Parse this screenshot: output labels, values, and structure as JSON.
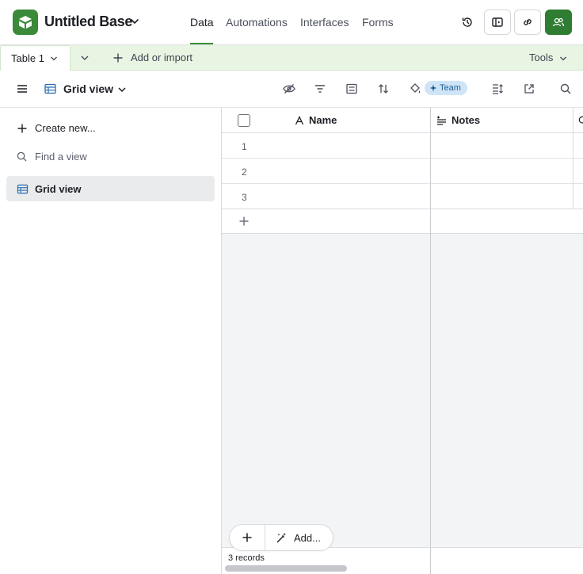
{
  "header": {
    "base_title": "Untitled Base",
    "nav": {
      "data": "Data",
      "automations": "Automations",
      "interfaces": "Interfaces",
      "forms": "Forms"
    },
    "icons": [
      "history-icon",
      "launch-interface-icon",
      "share-link-icon",
      "collaborators-icon"
    ]
  },
  "tablebar": {
    "table_tab": "Table 1",
    "add_import": "Add or import",
    "tools": "Tools"
  },
  "viewbar": {
    "view_name": "Grid view",
    "team_badge": "Team"
  },
  "sidebar": {
    "create_new": "Create new...",
    "find_view_placeholder": "Find a view",
    "views": [
      {
        "label": "Grid view",
        "selected": true
      }
    ]
  },
  "grid": {
    "columns": [
      {
        "label": "Name",
        "type": "primary-text"
      },
      {
        "label": "Notes",
        "type": "long-text"
      }
    ],
    "rows": [
      {
        "num": "1",
        "name": "",
        "notes": ""
      },
      {
        "num": "2",
        "name": "",
        "notes": ""
      },
      {
        "num": "3",
        "name": "",
        "notes": ""
      }
    ]
  },
  "footer": {
    "records": "3 records",
    "add_label": "Add..."
  },
  "colors": {
    "brand_green": "#3a8a3a",
    "table_bar_bg": "#e8f5e3",
    "team_badge_bg": "#cfe5f7"
  }
}
